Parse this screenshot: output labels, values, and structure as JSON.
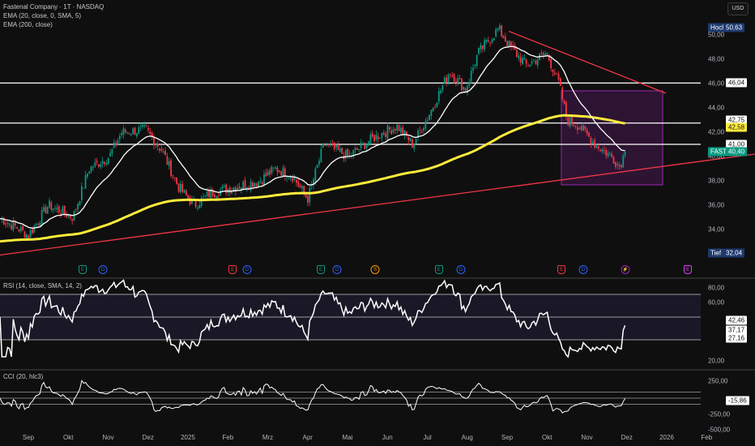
{
  "header": {
    "title": "Fastenal Company · 1T · NASDAQ",
    "indicator1": "EMA (20, close, 0, SMA, 5)",
    "indicator2": "EMA (200, close)",
    "currency_button": "USD"
  },
  "colors": {
    "up": "#089981",
    "down": "#f23645",
    "ema20": "#ffffff",
    "ema200": "#ffeb3b",
    "trendline": "#f23645",
    "box": "#9c27b0",
    "background": "#0f0f0f"
  },
  "chart_data": {
    "type": "candlestick",
    "symbol": "FAST",
    "x_unit": "months since 2024-09-01",
    "time_labels": [
      "Sep",
      "Okt",
      "Nov",
      "Dez",
      "2025",
      "Feb",
      "Mrz",
      "Apr",
      "Mai",
      "Jun",
      "Jul",
      "Aug",
      "Sep",
      "Okt",
      "Nov",
      "Dez",
      "2026",
      "Feb"
    ],
    "price_ylim": [
      31.5,
      51.5
    ],
    "price_ticks": [
      "50,00",
      "48,00",
      "46,00",
      "44,00",
      "42,00",
      "40,00",
      "38,00",
      "36,00",
      "34,00"
    ],
    "close_keypoints": [
      [
        -0.71,
        34.9
      ],
      [
        -0.3,
        34.2
      ],
      [
        0.0,
        33.5
      ],
      [
        0.5,
        36.0
      ],
      [
        1.12,
        35.0
      ],
      [
        1.52,
        39.0
      ],
      [
        2.03,
        40.0
      ],
      [
        2.34,
        42.0
      ],
      [
        2.94,
        42.2
      ],
      [
        3.35,
        40.5
      ],
      [
        3.76,
        37.5
      ],
      [
        4.16,
        36.0
      ],
      [
        4.57,
        37.0
      ],
      [
        5.18,
        37.5
      ],
      [
        5.79,
        38.0
      ],
      [
        6.19,
        39.0
      ],
      [
        6.6,
        38.5
      ],
      [
        7.0,
        36.5
      ],
      [
        7.41,
        41.0
      ],
      [
        8.02,
        40.0
      ],
      [
        8.63,
        41.5
      ],
      [
        9.24,
        42.5
      ],
      [
        9.64,
        41.0
      ],
      [
        10.05,
        43.5
      ],
      [
        10.56,
        47.0
      ],
      [
        10.96,
        45.5
      ],
      [
        11.27,
        48.5
      ],
      [
        11.78,
        50.5
      ],
      [
        12.08,
        49.0
      ],
      [
        12.49,
        47.5
      ],
      [
        12.995,
        48.5
      ],
      [
        13.3,
        46.0
      ],
      [
        13.5,
        43.0
      ],
      [
        13.81,
        42.5
      ],
      [
        14.21,
        41.0
      ],
      [
        14.62,
        40.0
      ],
      [
        14.82,
        39.2
      ],
      [
        14.96,
        40.4
      ]
    ],
    "ema_fast_period": 20,
    "ema_slow_period": 200,
    "ema_slow_start": 33.0,
    "horizontal_levels": [
      46.04,
      42.75,
      41.0
    ],
    "trendlines": [
      {
        "name": "support",
        "from": [
          -0.71,
          31.9
        ],
        "to": [
          18.21,
          40.2
        ]
      },
      {
        "name": "resistance",
        "from": [
          12.04,
          50.3
        ],
        "to": [
          15.98,
          45.2
        ]
      }
    ],
    "box": {
      "t0": 13.36,
      "t1": 15.9,
      "p_high": 45.4,
      "p_low": 37.67
    },
    "badges": {
      "high": {
        "label": "Hoch",
        "value": "50,63"
      },
      "low": {
        "label": "Tief",
        "value": "32,04"
      },
      "last": {
        "label": "FAST",
        "value": "40,40"
      },
      "ema200_value": "42,58",
      "levels": [
        "46,04",
        "42,75",
        "41,00"
      ]
    },
    "events": [
      {
        "t": 1.36,
        "letter": "E",
        "color": "#089981",
        "shape": "shield"
      },
      {
        "t": 1.87,
        "letter": "D",
        "color": "#2962ff",
        "shape": "circle"
      },
      {
        "t": 5.12,
        "letter": "E",
        "color": "#f23645",
        "shape": "shield"
      },
      {
        "t": 5.48,
        "letter": "D",
        "color": "#2962ff",
        "shape": "circle"
      },
      {
        "t": 7.33,
        "letter": "E",
        "color": "#089981",
        "shape": "shield"
      },
      {
        "t": 7.74,
        "letter": "D",
        "color": "#2962ff",
        "shape": "circle"
      },
      {
        "t": 8.69,
        "letter": "S",
        "color": "#ff9800",
        "shape": "circle"
      },
      {
        "t": 10.29,
        "letter": "E",
        "color": "#089981",
        "shape": "shield"
      },
      {
        "t": 10.84,
        "letter": "D",
        "color": "#2962ff",
        "shape": "circle"
      },
      {
        "t": 13.36,
        "letter": "E",
        "color": "#f23645",
        "shape": "shield"
      },
      {
        "t": 13.91,
        "letter": "D",
        "color": "#2962ff",
        "shape": "circle"
      },
      {
        "t": 14.96,
        "letter": "⚡",
        "color": "#9c27b0",
        "shape": "circle"
      },
      {
        "t": 16.53,
        "letter": "E",
        "color": "#e040fb",
        "shape": "shield"
      }
    ],
    "rsi": {
      "title": "RSI (14, close, SMA, 14, 2)",
      "period": 14,
      "bands": [
        70,
        50,
        30
      ],
      "ticks": [
        "80,00",
        "60,00",
        "20,00"
      ],
      "values": [
        "42,46",
        "37,17",
        "27,16"
      ]
    },
    "cci": {
      "title": "CCI (20, hlc3)",
      "period": 20,
      "bands": [
        100,
        0,
        -100
      ],
      "ticks": [
        "250,00",
        "-250,00",
        "-500,00"
      ],
      "value": "-15,86"
    }
  }
}
